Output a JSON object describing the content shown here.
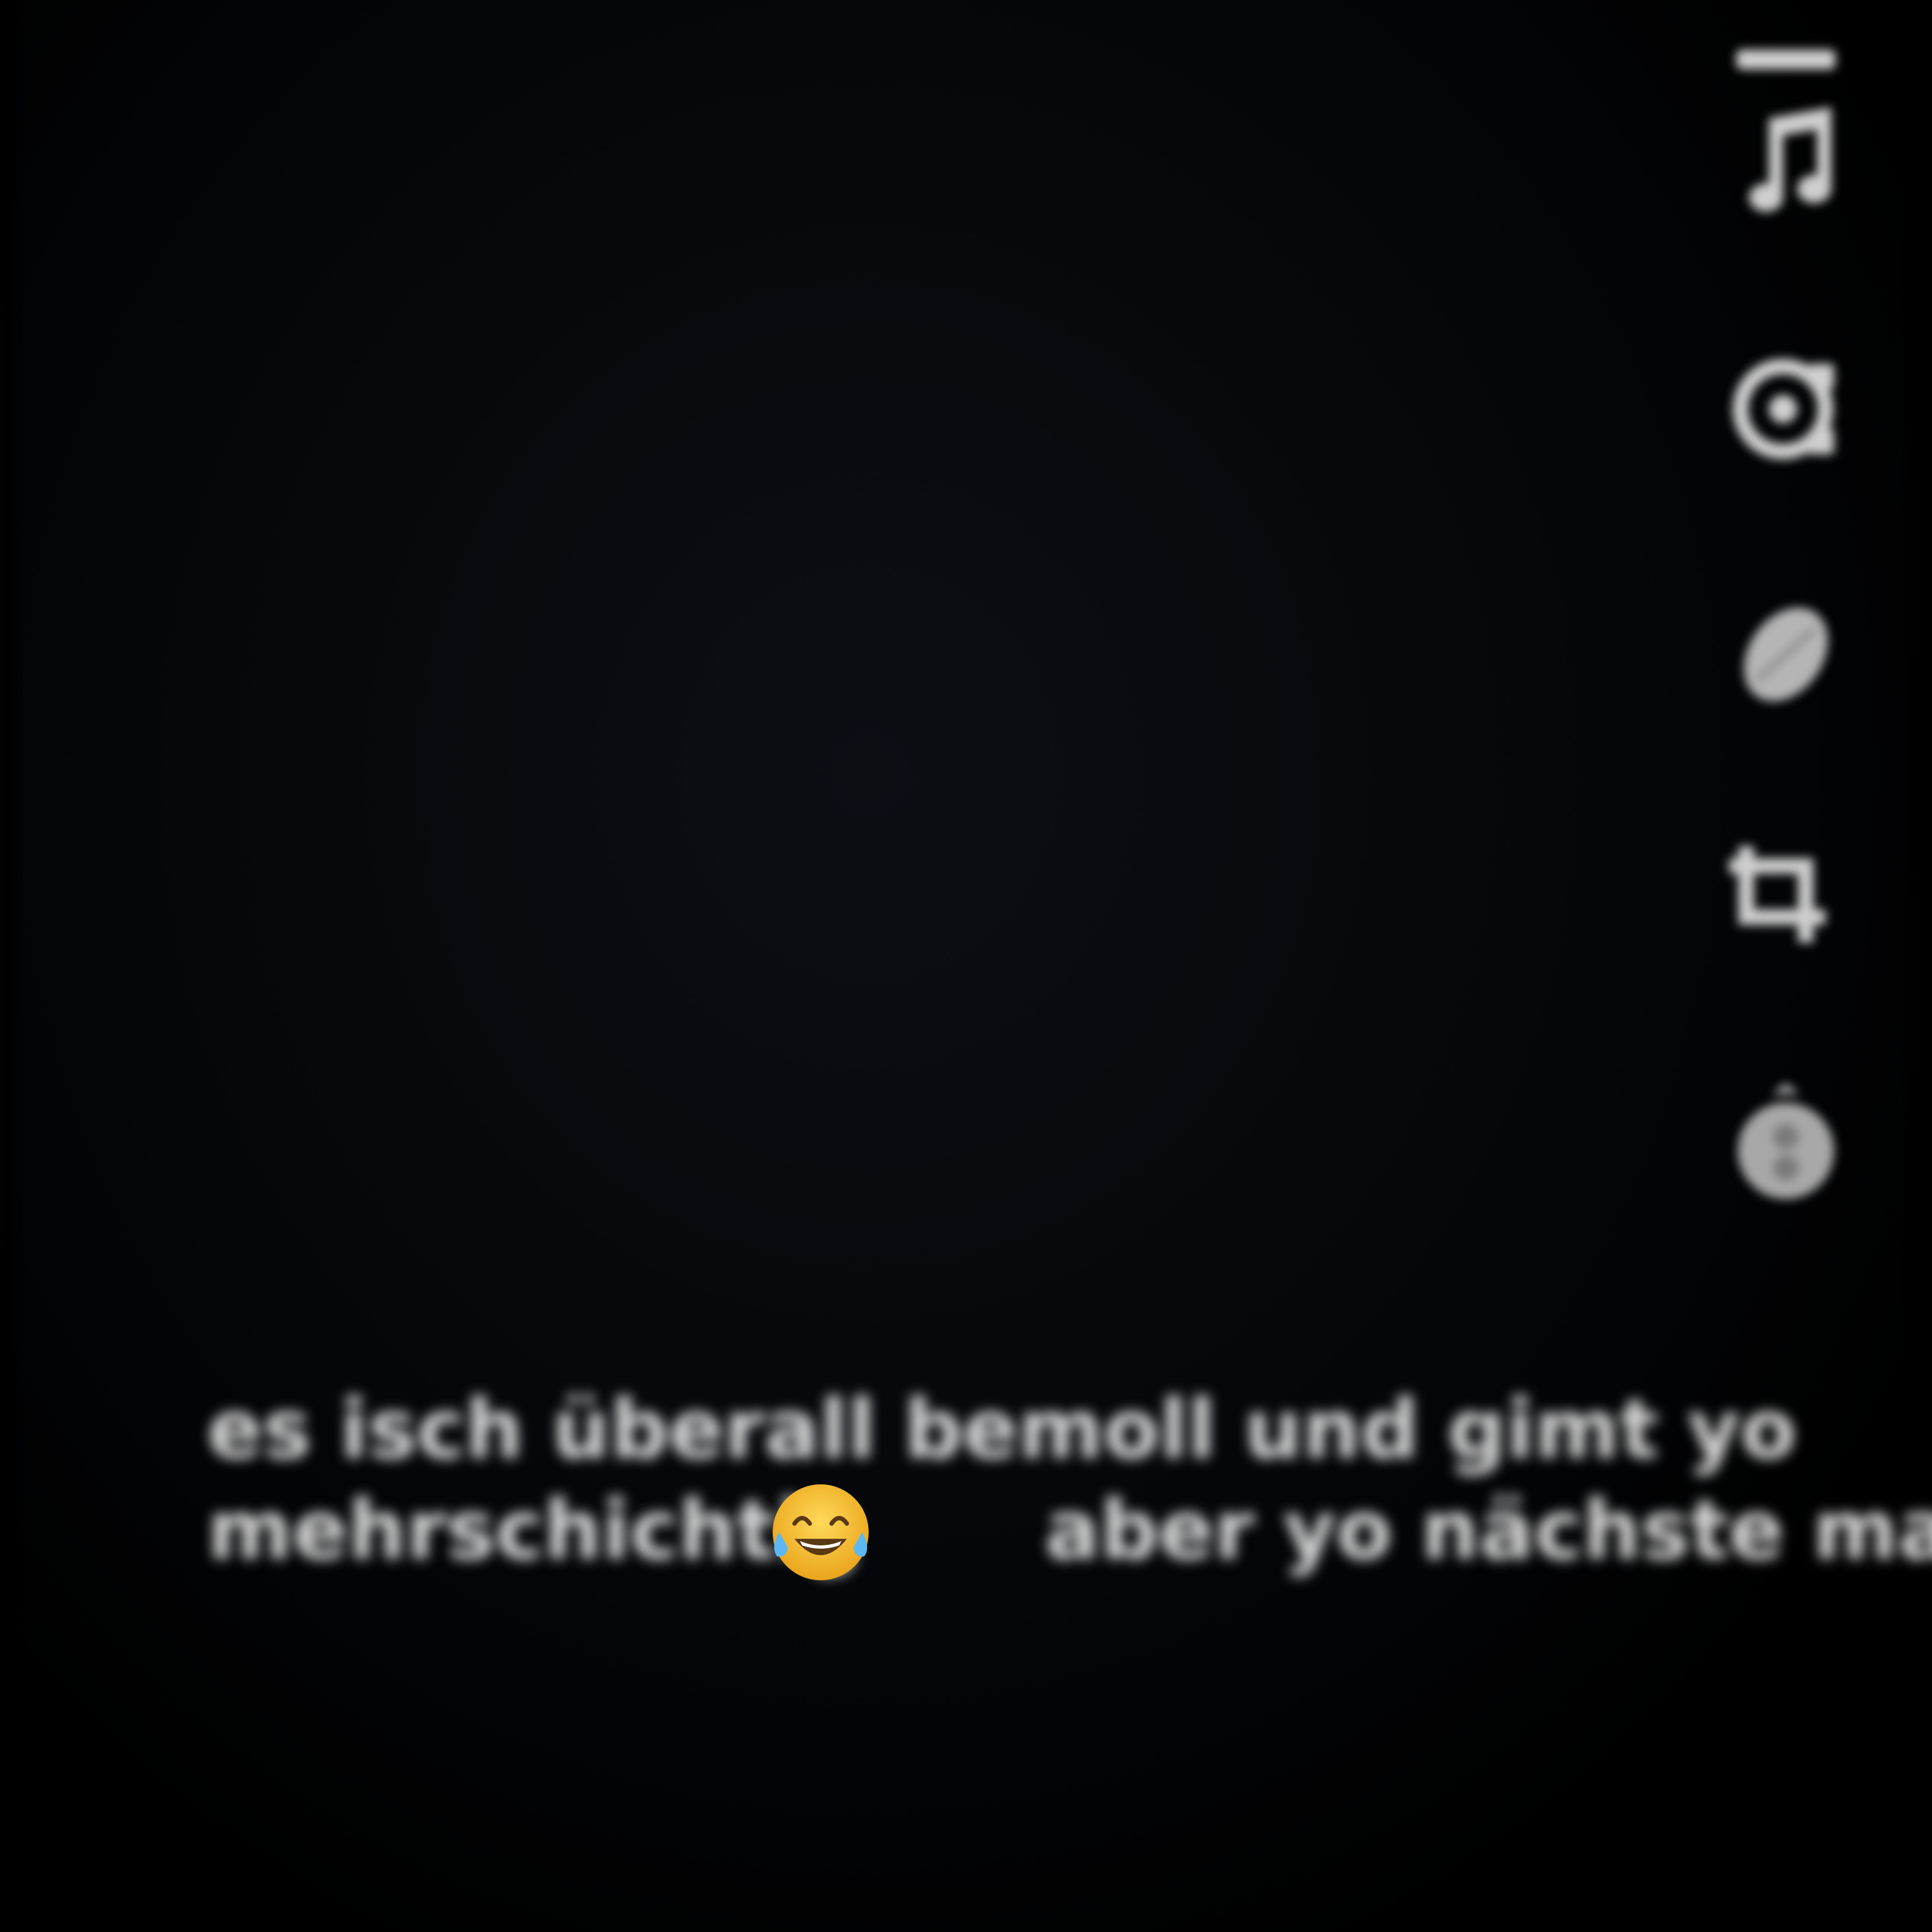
{
  "caption": {
    "line1": "es isch überall bemoll und gimt yo",
    "line2_before_emoji": "mehrschichtig",
    "line2_after_emoji": "aber yo nächste mal",
    "emoji": "face-with-tears-of-joy-icon"
  },
  "tools": [
    {
      "name": "text-tool",
      "icon": "text-icon"
    },
    {
      "name": "music-tool",
      "icon": "music-note-icon"
    },
    {
      "name": "mention-tool",
      "icon": "link-icon"
    },
    {
      "name": "sticker-tool",
      "icon": "sticker-icon"
    },
    {
      "name": "crop-tool",
      "icon": "crop-icon"
    },
    {
      "name": "timer-tool",
      "icon": "timer-icon"
    }
  ],
  "colors": {
    "background": "#000000",
    "icon": "#cfcfcf",
    "caption_text": "#d9d9d9",
    "emoji_yellow": "#f7c531"
  }
}
